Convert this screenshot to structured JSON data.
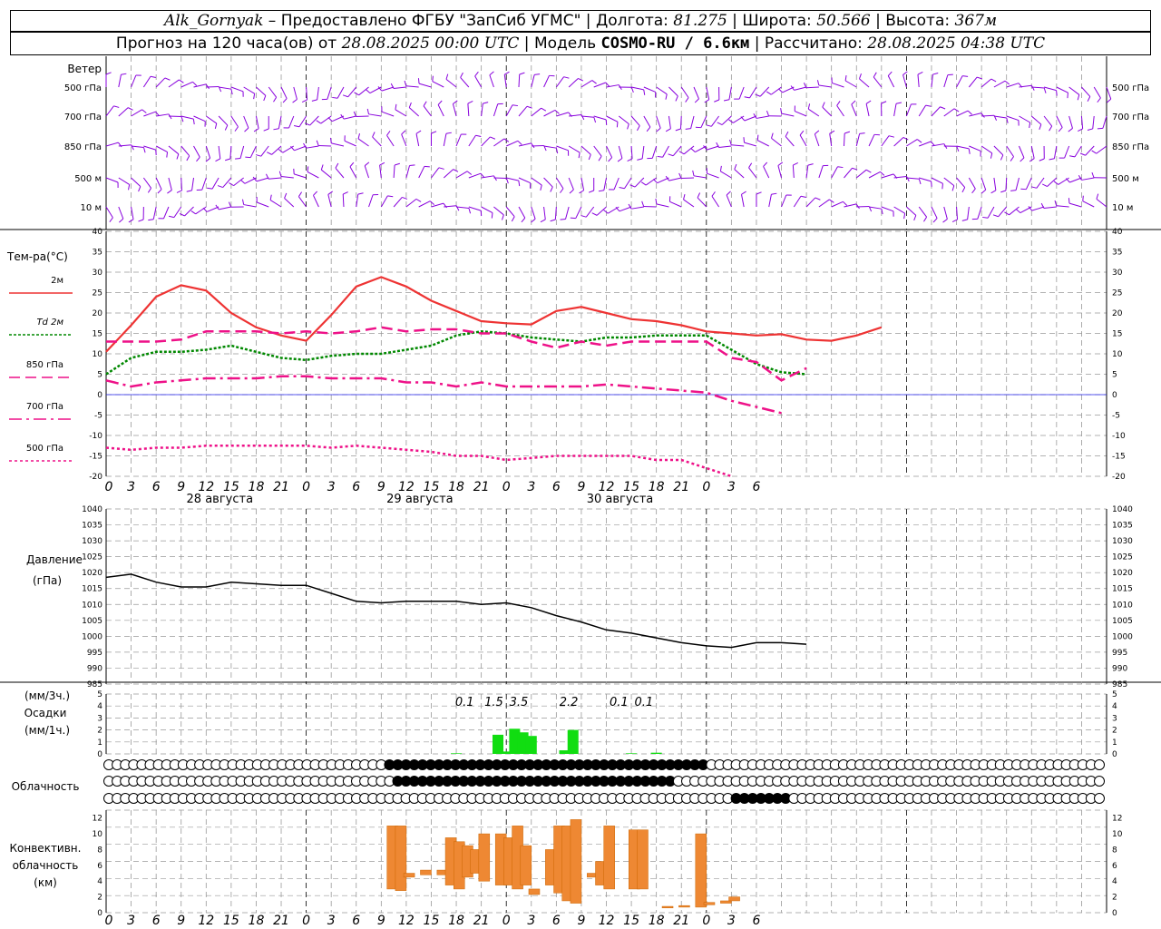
{
  "header": {
    "station": "Alk_Gornyak",
    "dash": "–",
    "provider": "Предоставлено ФГБУ \"ЗапСиб УГМС\"",
    "lon_label": "Долгота:",
    "lon": "81.275",
    "lat_label": "Широта:",
    "lat": "50.566",
    "alt_label": "Высота:",
    "alt": "367м",
    "forecast_label": "Прогноз на 120 часа(ов)  от",
    "forecast_start": "28.08.2025 00:00 UTC",
    "model_label": "Модель",
    "model": "COSMO-RU / 6.6км",
    "computed_label": "Рассчитано:",
    "computed": "28.08.2025 04:38 UTC"
  },
  "colors": {
    "t2m": "#ee3333",
    "td2m": "#008800",
    "t850": "#ee1188",
    "t700": "#ee1188",
    "t500": "#ee1188",
    "wind": "#8800dd",
    "pressure": "#000000",
    "precip": "#11dd11",
    "conv": "#ee8833",
    "zero_line": "#2222ee"
  },
  "wind_panel": {
    "title": "Ветер",
    "levels": [
      "500 гПа",
      "700 гПа",
      "850 гПа",
      "500 м",
      "10  м"
    ]
  },
  "time_axis": {
    "hour_ticks": [
      "0",
      "3",
      "6",
      "9",
      "12",
      "15",
      "18",
      "21",
      "0",
      "3",
      "6",
      "9",
      "12",
      "15",
      "18",
      "21",
      "0",
      "3",
      "6",
      "9",
      "12",
      "15",
      "18",
      "21",
      "0",
      "3",
      "6"
    ],
    "days": [
      "28 августа",
      "29 августа",
      "30 августа"
    ]
  },
  "chart_data": [
    {
      "type": "line",
      "name": "temperature",
      "title": "Тем-ра(°C)",
      "ylim": [
        -20,
        40
      ],
      "yticks": [
        "40",
        "35",
        "30",
        "25",
        "20",
        "15",
        "10",
        "5",
        "0",
        "-5",
        "-10",
        "-15",
        "-20"
      ],
      "x_unit": "hours since 28.08.2025 00:00 UTC",
      "legend": [
        {
          "key": "t2m",
          "label": "2м"
        },
        {
          "key": "td2m",
          "label": "Td  2м"
        },
        {
          "key": "t850",
          "label": "850 гПа"
        },
        {
          "key": "t700",
          "label": "700 гПа"
        },
        {
          "key": "t500",
          "label": "500 гПа"
        }
      ],
      "series": [
        {
          "key": "t2m",
          "name": "2м",
          "x": [
            0,
            3,
            6,
            9,
            12,
            15,
            18,
            21,
            24,
            27,
            30,
            33,
            36,
            39,
            42,
            45,
            48,
            51,
            54,
            57,
            60,
            63,
            66,
            69,
            72,
            75,
            78,
            81,
            84,
            87,
            90,
            93,
            96,
            99,
            102,
            105,
            108,
            111,
            114,
            117,
            120
          ],
          "values": [
            10.5,
            17,
            24,
            26.8,
            25.5,
            20,
            16.5,
            14.5,
            13.2,
            19.5,
            26.5,
            28.8,
            26.5,
            23,
            20.5,
            18,
            17.5,
            17.2,
            20.5,
            21.5,
            20,
            18.5,
            18,
            17,
            15.5,
            15,
            14.5,
            14.8,
            13.5,
            13.2,
            14.5,
            16.5,
            null,
            null,
            null,
            null,
            null,
            null,
            null,
            null,
            null
          ]
        },
        {
          "key": "td2m",
          "name": "Td  2м",
          "x": [
            0,
            3,
            6,
            9,
            12,
            15,
            18,
            21,
            24,
            27,
            30,
            33,
            36,
            39,
            42,
            45,
            48,
            51,
            54,
            57,
            60,
            63,
            66,
            69,
            72,
            75,
            78,
            81,
            84,
            87,
            90,
            93,
            96,
            99,
            102,
            105,
            108,
            111,
            114,
            117,
            120
          ],
          "values": [
            5,
            9,
            10.5,
            10.5,
            11,
            12,
            10.5,
            9,
            8.5,
            9.5,
            10,
            10,
            11,
            12,
            14.5,
            15.5,
            15,
            14,
            13.5,
            13,
            14,
            14,
            14.5,
            14.5,
            14.5,
            11,
            7.5,
            5.5,
            5,
            null,
            null,
            null,
            null,
            null,
            null,
            null,
            null,
            null,
            null,
            null,
            null
          ]
        },
        {
          "key": "t850",
          "name": "850 гПа",
          "x": [
            0,
            3,
            6,
            9,
            12,
            15,
            18,
            21,
            24,
            27,
            30,
            33,
            36,
            39,
            42,
            45,
            48,
            51,
            54,
            57,
            60,
            63,
            66,
            69,
            72,
            75,
            78,
            81,
            84,
            87,
            90,
            93,
            96,
            99,
            102,
            105,
            108,
            111,
            114,
            117,
            120
          ],
          "values": [
            13,
            13,
            13,
            13.5,
            15.5,
            15.5,
            15.5,
            15,
            15.5,
            15,
            15.5,
            16.5,
            15.5,
            16,
            16,
            15,
            15,
            13,
            11.5,
            13,
            12,
            13,
            13,
            13,
            13,
            9,
            8,
            3.5,
            6.5,
            null,
            null,
            null,
            null,
            null,
            null,
            null,
            null,
            null,
            null,
            null,
            null
          ]
        },
        {
          "key": "t700",
          "name": "700 гПа",
          "x": [
            0,
            3,
            6,
            9,
            12,
            15,
            18,
            21,
            24,
            27,
            30,
            33,
            36,
            39,
            42,
            45,
            48,
            51,
            54,
            57,
            60,
            63,
            66,
            69,
            72,
            75,
            78,
            81,
            84,
            87,
            90,
            93,
            96,
            99,
            102,
            105,
            108,
            111,
            114,
            117,
            120
          ],
          "values": [
            3.5,
            2,
            3,
            3.5,
            4,
            4,
            4,
            4.5,
            4.5,
            4,
            4,
            4,
            3,
            3,
            2,
            3,
            2,
            2,
            2,
            2,
            2.5,
            2,
            1.5,
            1,
            0.5,
            -1.5,
            -3,
            -4.5,
            null,
            null,
            null,
            null,
            null,
            null,
            null,
            null,
            null,
            null,
            null,
            null,
            null
          ]
        },
        {
          "key": "t500",
          "name": "500 гПа",
          "x": [
            0,
            3,
            6,
            9,
            12,
            15,
            18,
            21,
            24,
            27,
            30,
            33,
            36,
            39,
            42,
            45,
            48,
            51,
            54,
            57,
            60,
            63,
            66,
            69,
            72,
            75,
            78,
            81,
            84,
            87,
            90,
            93,
            96,
            99,
            102,
            105,
            108,
            111,
            114,
            117,
            120
          ],
          "values": [
            -13,
            -13.5,
            -13,
            -13,
            -12.5,
            -12.5,
            -12.5,
            -12.5,
            -12.5,
            -13,
            -12.5,
            -13,
            -13.5,
            -14,
            -15,
            -15,
            -16,
            -15.5,
            -15,
            -15,
            -15,
            -15,
            -16,
            -16,
            -18,
            -20,
            null,
            null,
            null,
            null,
            null,
            null,
            null,
            null,
            null,
            null,
            null,
            null,
            null,
            null,
            null
          ]
        }
      ]
    },
    {
      "type": "line",
      "name": "pressure",
      "title": "Давление",
      "unit_label": "(гПа)",
      "ylim": [
        985,
        1040
      ],
      "yticks": [
        "1040",
        "1035",
        "1030",
        "1025",
        "1020",
        "1015",
        "1010",
        "1005",
        "1000",
        "995",
        "990",
        "985"
      ],
      "x": [
        0,
        3,
        6,
        9,
        12,
        15,
        18,
        21,
        24,
        27,
        30,
        33,
        36,
        39,
        42,
        45,
        48,
        51,
        54,
        57,
        60,
        63,
        66,
        69,
        72,
        75,
        78,
        81,
        84,
        87,
        90,
        93,
        96,
        99,
        102,
        105,
        108,
        111,
        114,
        117,
        120
      ],
      "series": [
        {
          "key": "pressure",
          "values": [
            1018.5,
            1019.5,
            1017,
            1015.5,
            1015.5,
            1017,
            1016.5,
            1016,
            1016,
            1013.5,
            1011,
            1010.5,
            1011,
            1011,
            1011,
            1010,
            1010.5,
            1009,
            1006.5,
            1004.5,
            1002,
            1001,
            999.5,
            998,
            997,
            996.5,
            998,
            998,
            997.5,
            null,
            null,
            null,
            null,
            null,
            null,
            null,
            null,
            null,
            null,
            null,
            null
          ]
        }
      ]
    },
    {
      "type": "bar",
      "name": "precipitation",
      "title": "Осадки",
      "unit_top": "(мм/3ч.)",
      "unit_bottom": "(мм/1ч.)",
      "ylim": [
        0,
        5
      ],
      "yticks": [
        "5",
        "4",
        "3",
        "2",
        "1",
        "0"
      ],
      "x_hours": [
        42,
        47,
        48,
        49,
        50,
        51,
        55,
        56,
        63,
        66
      ],
      "values": [
        0.05,
        1.6,
        0.2,
        2.1,
        1.8,
        1.5,
        0.3,
        2.0,
        0.05,
        0.1
      ],
      "labels": [
        {
          "hour": 43,
          "text": "0.1"
        },
        {
          "hour": 46.5,
          "text": "1.5"
        },
        {
          "hour": 49.5,
          "text": "3.5"
        },
        {
          "hour": 55.5,
          "text": "2.2"
        },
        {
          "hour": 61.5,
          "text": "0.1"
        },
        {
          "hour": 64.5,
          "text": "0.1"
        }
      ]
    },
    {
      "type": "bar",
      "name": "convective_cloudiness",
      "title": "Конвективн. облачность (км)",
      "title_lines": [
        "Конвективн.",
        "облачность",
        "(км)"
      ],
      "ylim": [
        0,
        13
      ],
      "yticks": [
        "12",
        "10",
        "8",
        "6",
        "4",
        "2",
        "0"
      ],
      "bars": [
        {
          "h": 35,
          "base": 3,
          "top": 11
        },
        {
          "h": 36,
          "base": 2.8,
          "top": 11
        },
        {
          "h": 37,
          "base": 4.5,
          "top": 5
        },
        {
          "h": 39,
          "base": 4.8,
          "top": 5.4
        },
        {
          "h": 41,
          "base": 4.8,
          "top": 5.4
        },
        {
          "h": 42,
          "base": 3.5,
          "top": 9.5
        },
        {
          "h": 43,
          "base": 3,
          "top": 9
        },
        {
          "h": 44,
          "base": 4.5,
          "top": 8.5
        },
        {
          "h": 45,
          "base": 5,
          "top": 8
        },
        {
          "h": 46,
          "base": 4,
          "top": 10
        },
        {
          "h": 48,
          "base": 3.5,
          "top": 10
        },
        {
          "h": 49,
          "base": 3.5,
          "top": 9.5
        },
        {
          "h": 50,
          "base": 3,
          "top": 11
        },
        {
          "h": 51,
          "base": 3.5,
          "top": 8.5
        },
        {
          "h": 52,
          "base": 2.3,
          "top": 3
        },
        {
          "h": 54,
          "base": 3.5,
          "top": 8
        },
        {
          "h": 55,
          "base": 2.5,
          "top": 11
        },
        {
          "h": 56,
          "base": 1.5,
          "top": 11
        },
        {
          "h": 57,
          "base": 1.2,
          "top": 11.8
        },
        {
          "h": 59,
          "base": 4.5,
          "top": 5
        },
        {
          "h": 60,
          "base": 3.5,
          "top": 6.5
        },
        {
          "h": 61,
          "base": 3,
          "top": 11
        },
        {
          "h": 64,
          "base": 3,
          "top": 10.5
        },
        {
          "h": 65,
          "base": 3,
          "top": 10.5
        },
        {
          "h": 68,
          "base": 0.6,
          "top": 0.8
        },
        {
          "h": 70,
          "base": 0.7,
          "top": 0.9
        },
        {
          "h": 72,
          "base": 0.7,
          "top": 10
        },
        {
          "h": 73,
          "base": 1,
          "top": 1.3
        },
        {
          "h": 75,
          "base": 1.2,
          "top": 1.5
        },
        {
          "h": 76,
          "base": 1.5,
          "top": 2
        }
      ]
    }
  ],
  "cloud_panel": {
    "title": "Облачность"
  }
}
